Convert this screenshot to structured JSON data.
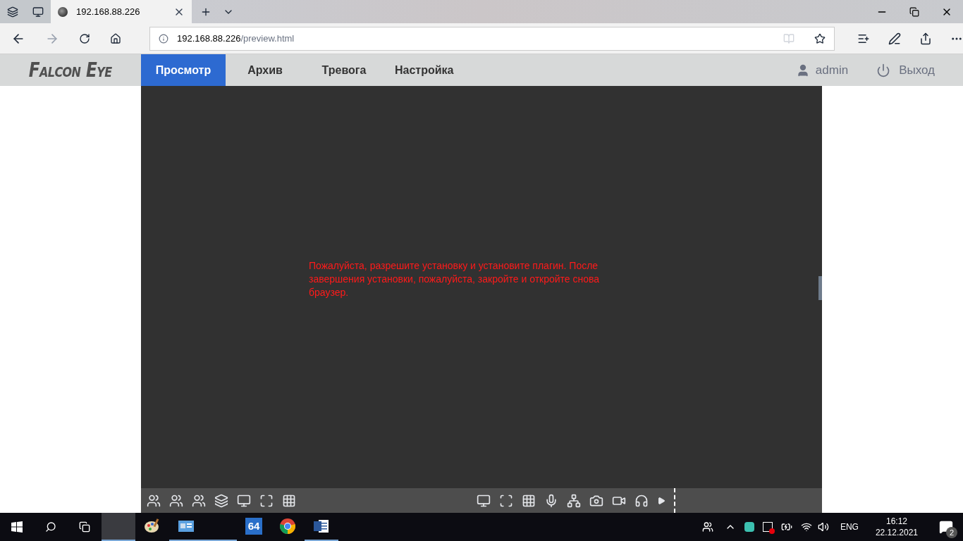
{
  "browser": {
    "tab_title": "192.168.88.226",
    "address_host": "192.168.88.226",
    "address_path": "/preview.html"
  },
  "nav": {
    "logo": "Falcon Eye",
    "items": [
      {
        "label": "Просмотр",
        "selected": true
      },
      {
        "label": "Архив",
        "selected": false
      },
      {
        "label": "Тревога",
        "selected": false
      },
      {
        "label": "Настройка",
        "selected": false
      }
    ],
    "user": "admin",
    "logout": "Выход"
  },
  "viewer": {
    "message": "Пожалуйста, разрешите установку и установите плагин. После завершения установки, пожалуйста, закройте и откройте снова браузер."
  },
  "taskbar": {
    "apps": [
      {
        "kind": "blank",
        "selected": true,
        "running": true
      },
      {
        "kind": "paint",
        "selected": false,
        "running": false
      },
      {
        "kind": "screen",
        "selected": false,
        "running": true
      },
      {
        "kind": "blank",
        "selected": false,
        "running": true
      },
      {
        "kind": "tile",
        "label": "64",
        "selected": false,
        "running": false
      },
      {
        "kind": "chrome",
        "selected": false,
        "running": false
      },
      {
        "kind": "word",
        "selected": false,
        "running": true
      }
    ],
    "language": "ENG",
    "time": "16:12",
    "date": "22.12.2021",
    "notifications": "2"
  }
}
